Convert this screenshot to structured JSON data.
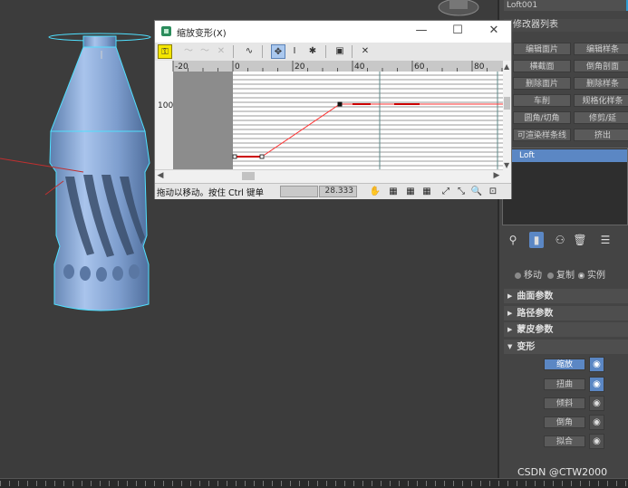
{
  "object_name": "Loft001",
  "modifier_list_label": "修改器列表",
  "modifier_buttons": [
    [
      "编辑面片",
      "编辑样条"
    ],
    [
      "横截面",
      "倒角剖面"
    ],
    [
      "删除面片",
      "删除样条"
    ],
    [
      "车削",
      "规格化样条"
    ],
    [
      "圆角/切角",
      "修剪/延"
    ],
    [
      "可渲染样条线",
      "挤出"
    ]
  ],
  "stack": {
    "item": "Loft"
  },
  "copy_options": {
    "move": "移动",
    "copy": "复制",
    "instance": "实例"
  },
  "rollouts": {
    "surface": "曲面参数",
    "path": "路径参数",
    "skin": "蒙皮参数",
    "deform": "变形"
  },
  "deform_buttons": [
    "缩放",
    "扭曲",
    "倾斜",
    "倒角",
    "拟合"
  ],
  "dialog": {
    "title": "缩放变形(X)",
    "ruler_labels": [
      "-20",
      "0",
      "20",
      "40",
      "60",
      "80"
    ],
    "y_label": "100",
    "status_text": "拖动以移动。按住 Ctrl 键单",
    "value_field": "",
    "value": "28.333"
  },
  "icons": {
    "minimize": "—",
    "maximize": "☐",
    "close": "✕",
    "pin": "📌"
  },
  "watermark": "CSDN @CTW2000"
}
